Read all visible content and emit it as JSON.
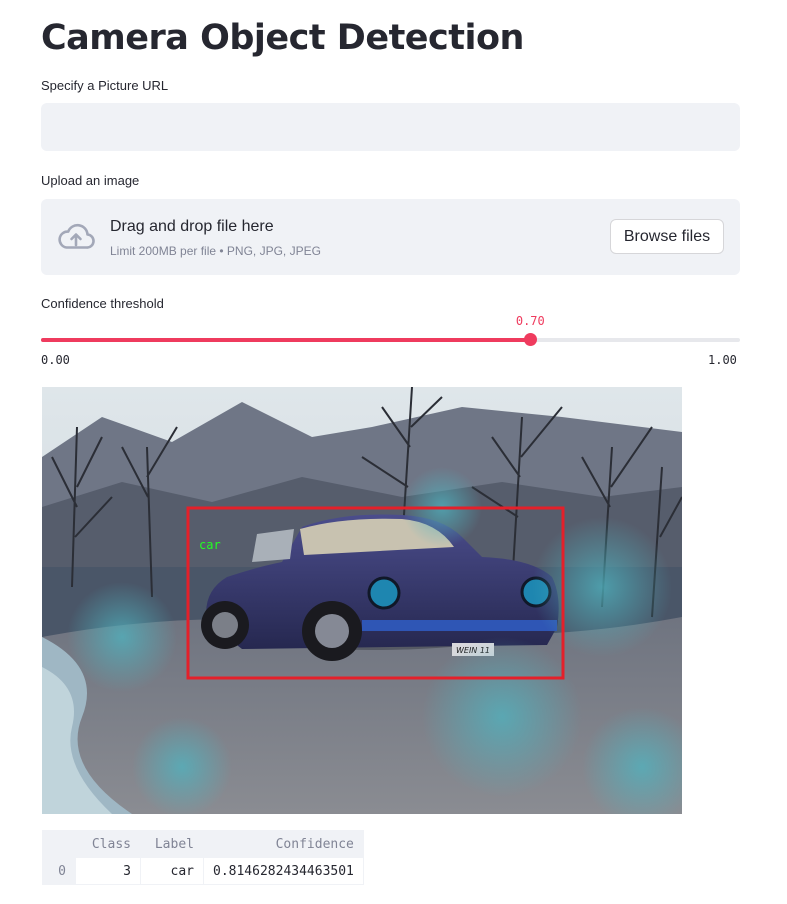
{
  "page": {
    "title": "Camera Object Detection"
  },
  "url_input": {
    "label": "Specify a Picture URL",
    "value": "",
    "placeholder": ""
  },
  "uploader": {
    "label": "Upload an image",
    "title": "Drag and drop file here",
    "subtitle": "Limit 200MB per file • PNG, JPG, JPEG",
    "button": "Browse files",
    "icon": "cloud-upload-icon"
  },
  "slider": {
    "label": "Confidence threshold",
    "value": 0.7,
    "value_label": "0.70",
    "min_label": "0.00",
    "max_label": "1.00",
    "color": "#ef3b5e"
  },
  "image": {
    "detection_label": "car",
    "plate_text": "WEIN 11",
    "box_color": "#e4202a",
    "label_color": "#22ff22"
  },
  "results_table": {
    "columns": [
      "",
      "Class",
      "Label",
      "Confidence"
    ],
    "rows": [
      {
        "index": "0",
        "class": "3",
        "label": "car",
        "confidence": "0.8146282434463501"
      }
    ]
  }
}
